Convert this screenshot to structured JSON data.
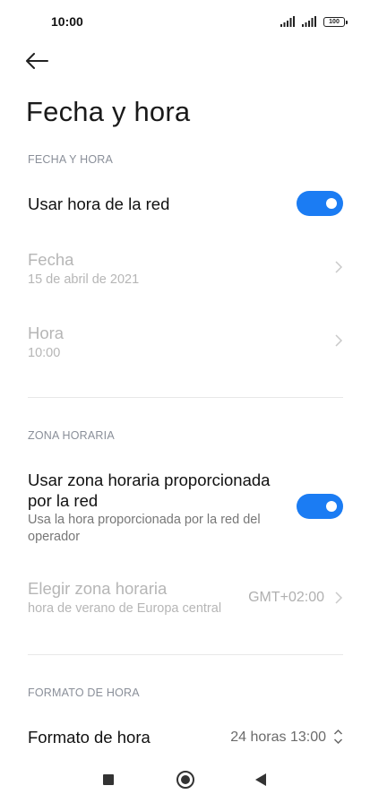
{
  "status_bar": {
    "time": "10:00",
    "battery": "100"
  },
  "page": {
    "title": "Fecha y hora"
  },
  "sections": {
    "date_time": {
      "header": "FECHA Y HORA",
      "network_time": {
        "label": "Usar hora de la red",
        "enabled": true
      },
      "date": {
        "label": "Fecha",
        "value": "15 de abril de 2021"
      },
      "time": {
        "label": "Hora",
        "value": "10:00"
      }
    },
    "time_zone": {
      "header": "ZONA HORARIA",
      "network_zone": {
        "label_line1": "Usar zona horaria proporcionada",
        "label_line2": "por la red",
        "desc_line1": "Usa la hora proporcionada por la red del",
        "desc_line2": "operador",
        "enabled": true
      },
      "choose_zone": {
        "label": "Elegir zona horaria",
        "desc": "hora de verano de Europa central",
        "value": "GMT+02:00"
      }
    },
    "time_format": {
      "header": "FORMATO DE HORA",
      "format": {
        "label": "Formato de hora",
        "value": "24 horas 13:00"
      }
    }
  },
  "colors": {
    "accent": "#1b7cf3",
    "disabled_text": "#b6b6b6",
    "section_header": "#8a8f99"
  }
}
